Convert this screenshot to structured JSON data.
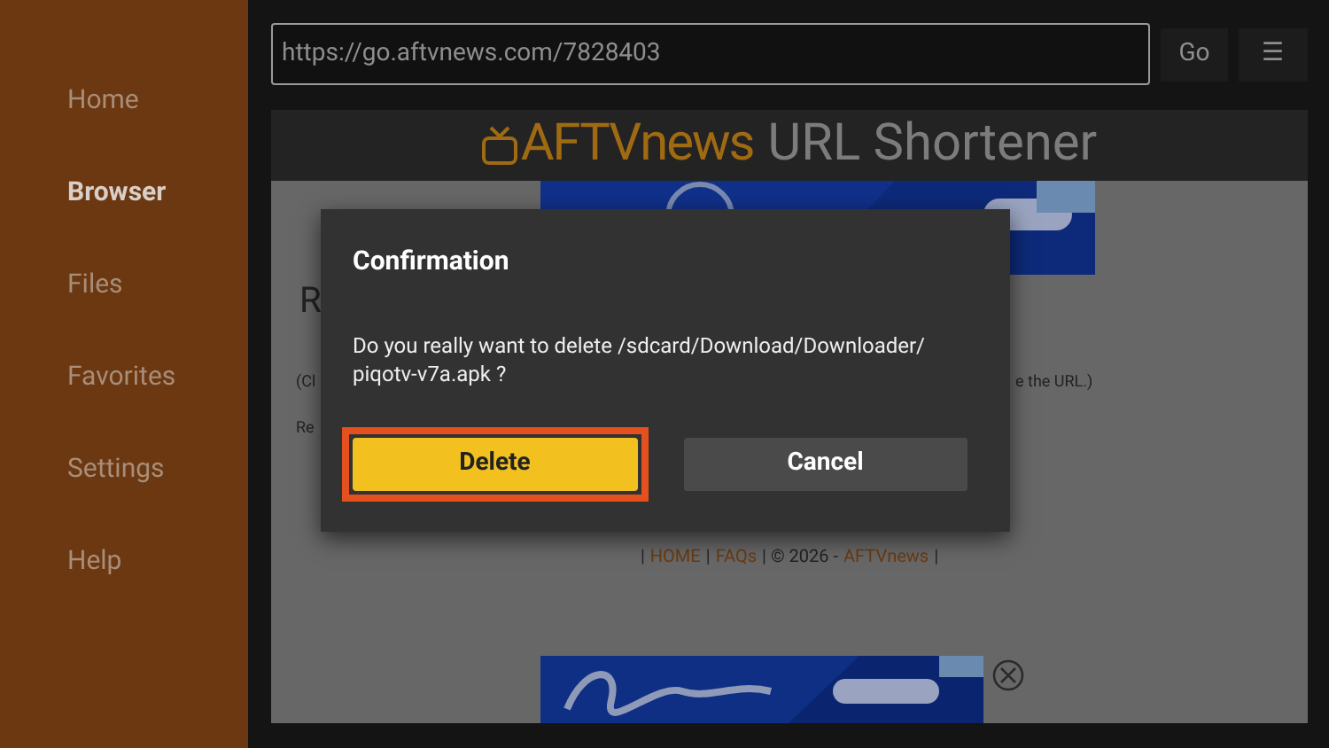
{
  "sidebar": {
    "items": [
      {
        "label": "Home",
        "selected": false
      },
      {
        "label": "Browser",
        "selected": true
      },
      {
        "label": "Files",
        "selected": false
      },
      {
        "label": "Favorites",
        "selected": false
      },
      {
        "label": "Settings",
        "selected": false
      },
      {
        "label": "Help",
        "selected": false
      }
    ]
  },
  "toolbar": {
    "url": "https://go.aftvnews.com/7828403",
    "go": "Go",
    "menu": "☰"
  },
  "page": {
    "logo": "AFTVnews",
    "title": "URL Shortener",
    "fragments": [
      "R",
      "(Cl",
      "Re",
      "e the URL.)"
    ],
    "footer": [
      {
        "text": "|",
        "link": false
      },
      {
        "text": "HOME",
        "link": true
      },
      {
        "text": "|",
        "link": false
      },
      {
        "text": "FAQs",
        "link": true
      },
      {
        "text": "| © 2026 -",
        "link": false
      },
      {
        "text": "AFTVnews",
        "link": true
      },
      {
        "text": "|",
        "link": false
      }
    ]
  },
  "dialog": {
    "title": "Confirmation",
    "message": "Do you really want to delete /sdcard/Download/Downloader/ piqotv-v7a.apk ?",
    "buttons": [
      {
        "label": "Delete",
        "focused": true
      },
      {
        "label": "Cancel",
        "focused": false
      }
    ]
  }
}
